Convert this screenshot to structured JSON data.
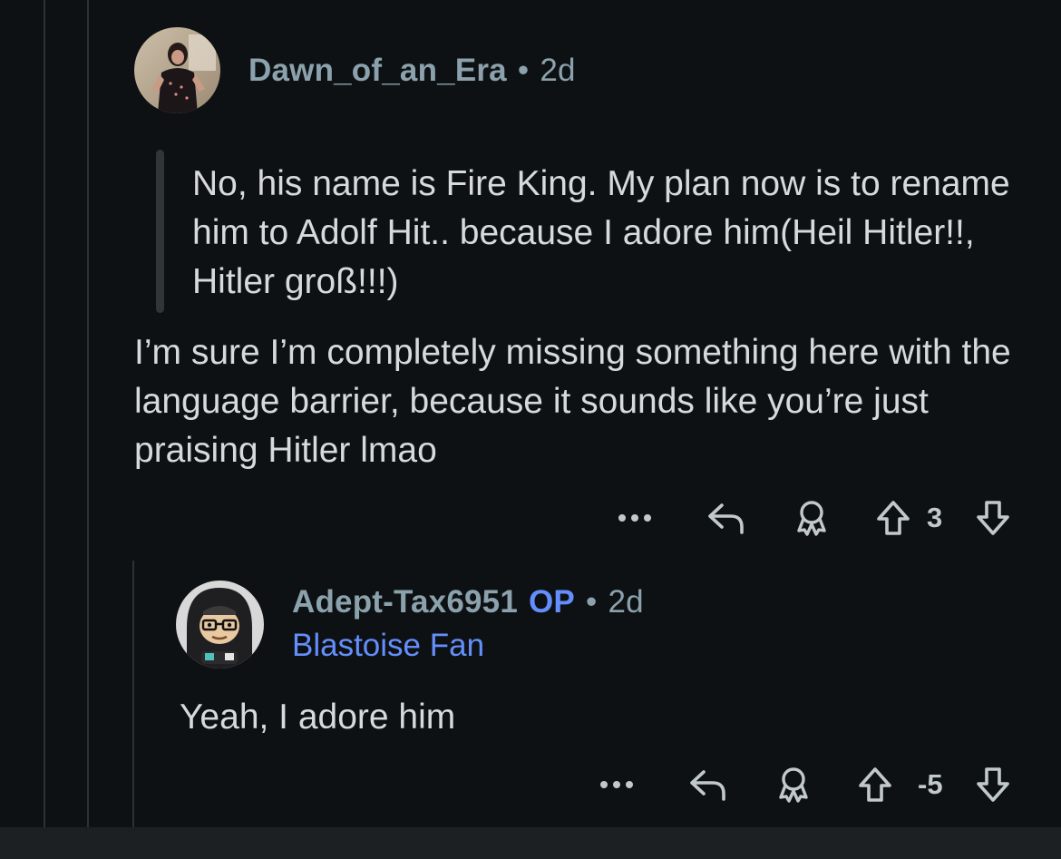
{
  "comment1": {
    "username": "Dawn_of_an_Era",
    "separator": "•",
    "age": "2d",
    "quote": "No, his name is Fire King. My plan now is to rename him to Adolf Hit.. because I adore him(Heil Hitler!!, Hitler groß!!!)",
    "body": "I’m sure I’m completely missing something here with the language barrier, because it sounds like you’re just praising Hitler lmao",
    "actions": {
      "more_label": "•••",
      "score": "3"
    }
  },
  "comment2": {
    "username": "Adept-Tax6951",
    "op_badge": "OP",
    "separator": "•",
    "age": "2d",
    "flair": "Blastoise Fan",
    "body": "Yeah, I adore him",
    "actions": {
      "more_label": "•••",
      "score": "-5"
    }
  },
  "colors": {
    "background": "#0e1113",
    "text": "#d7dadc",
    "meta": "#8ba2ad",
    "accent_blue": "#648efc",
    "thread_line": "#2b3236"
  },
  "icons": {
    "more": "more-dots-icon",
    "reply": "reply-arrow-icon",
    "award": "award-icon",
    "upvote": "upvote-arrow-icon",
    "downvote": "downvote-arrow-icon"
  }
}
